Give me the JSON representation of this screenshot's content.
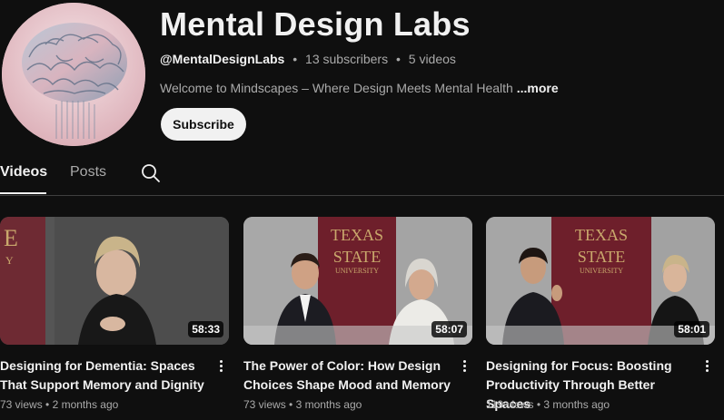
{
  "channel": {
    "title": "Mental Design Labs",
    "handle": "@MentalDesignLabs",
    "subscribers": "13 subscribers",
    "videos_count": "5 videos",
    "separator": "•",
    "description": "Welcome to Mindscapes – Where Design Meets Mental Health",
    "more_label": "...more",
    "subscribe_label": "Subscribe"
  },
  "tabs": [
    {
      "label": "Videos",
      "active": true
    },
    {
      "label": "Posts",
      "active": false
    }
  ],
  "thumb_signage": {
    "line1": "TEXAS",
    "line2": "STATE",
    "line3": "UNIVERSITY"
  },
  "videos": [
    {
      "title": "Designing for Dementia: Spaces That Support Memory and Dignity",
      "duration": "58:33",
      "views": "73 views",
      "age": "2 months ago"
    },
    {
      "title": "The Power of Color: How Design Choices Shape Mood and Memory",
      "duration": "58:07",
      "views": "73 views",
      "age": "3 months ago"
    },
    {
      "title": "Designing for Focus: Boosting Productivity Through Better Spaces",
      "duration": "58:01",
      "views": "119 views",
      "age": "3 months ago"
    }
  ],
  "colors": {
    "background": "#0f0f0f",
    "text_primary": "#f1f1f1",
    "text_secondary": "#aaaaaa",
    "subscribe_bg": "#f1f1f1",
    "divider": "#3f3f3f"
  }
}
